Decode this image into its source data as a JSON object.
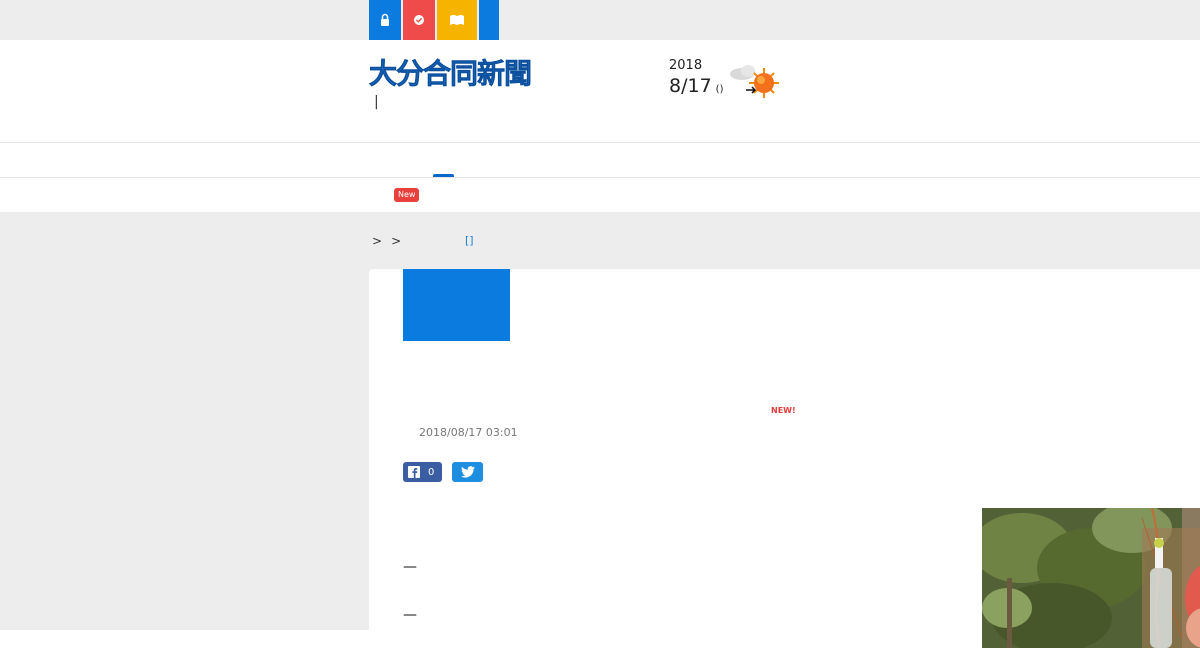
{
  "topbar": {
    "buttons": [
      {
        "icon": "lock-icon",
        "color": "#0b7be0"
      },
      {
        "icon": "check-circle-icon",
        "color": "#ef4b4b"
      },
      {
        "icon": "book-icon",
        "color": "#f6b300"
      },
      {
        "icon": "extra-icon",
        "color": "#0b7be0"
      }
    ]
  },
  "header": {
    "logo_text": "大分合同新聞",
    "logo_sub": "|",
    "date_year": "2018",
    "date_day": "8/17",
    "date_weekday": "()",
    "weather_icon": "cloudy-then-sunny-icon"
  },
  "nav": {
    "new_badge": "New"
  },
  "breadcrumb": {
    "sep1": ">",
    "sep2": ">",
    "link": "[]"
  },
  "article": {
    "new_label": "NEW!",
    "timestamp": "2018/08/17 03:01",
    "facebook_count": "0",
    "dash1": "—",
    "dash2": "—"
  },
  "colors": {
    "accent": "#0b7be0",
    "facebook": "#3b5ea3",
    "twitter": "#1d8ee0",
    "badge_red": "#e8403c"
  }
}
